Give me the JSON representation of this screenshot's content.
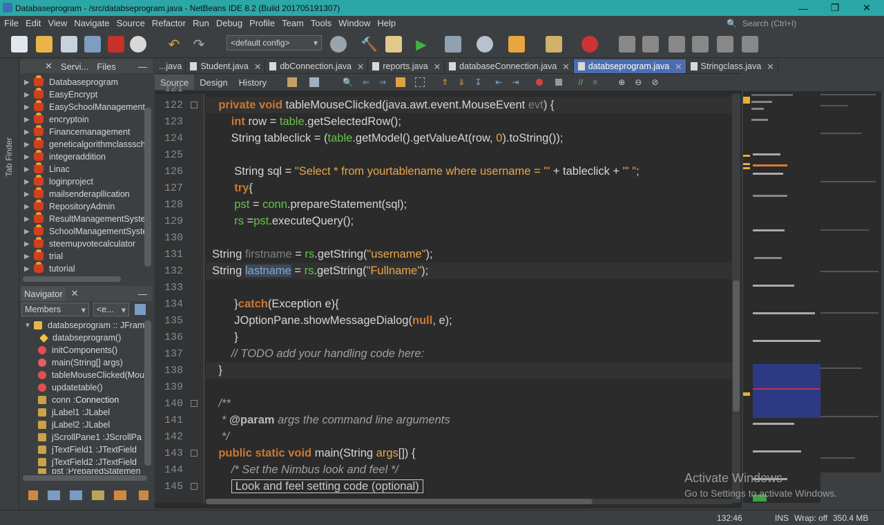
{
  "window": {
    "title": "Databaseprogram - /src/databseprogram.java - NetBeans IDE 8.2 (Build 201705191307)"
  },
  "menu": [
    "File",
    "Edit",
    "View",
    "Navigate",
    "Source",
    "Refactor",
    "Run",
    "Debug",
    "Profile",
    "Team",
    "Tools",
    "Window",
    "Help"
  ],
  "search": {
    "placeholder": "Search (Ctrl+I)"
  },
  "toolbar": {
    "config": "<default config>"
  },
  "left_strip": {
    "label": "Tab Finder"
  },
  "projects_panel": {
    "tabs": [
      "Servi...",
      "Files"
    ],
    "items": [
      "Databaseprogram",
      "EasyEncrypt",
      "EasySchoolManagement",
      "encryptoin",
      "Financemanagement",
      "geneticalgorithmclasssch",
      "integeraddition",
      "Linac",
      "loginproject",
      "mailsenderapllication",
      "RepositoryAdmin",
      "ResultManagementSyste",
      "SchoolManagementSyste",
      "steemupvotecalculator",
      "trial",
      "tutorial"
    ]
  },
  "navigator": {
    "title": "Navigator",
    "filter": "Members",
    "filter2": "<e...",
    "root": "databseprogram :: JFram",
    "members": [
      {
        "name": "databseprogram()",
        "type": ""
      },
      {
        "name": "initComponents()",
        "type": ""
      },
      {
        "name": "main(String[] args)",
        "type": ""
      },
      {
        "name": "tableMouseClicked(Mou",
        "type": ""
      },
      {
        "name": "updatetable()",
        "type": ""
      },
      {
        "name": "conn : ",
        "type": "Connection"
      },
      {
        "name": "jLabel1 : ",
        "type": "JLabel"
      },
      {
        "name": "jLabel2 : ",
        "type": "JLabel"
      },
      {
        "name": "jScrollPane1 : ",
        "type": "JScrollPa"
      },
      {
        "name": "jTextField1 : ",
        "type": "JTextField"
      },
      {
        "name": "jTextField2 : ",
        "type": "JTextField"
      },
      {
        "name": "pst : ",
        "type": "PreparedStatemen"
      }
    ]
  },
  "editor": {
    "tabs": [
      "...java",
      "Student.java",
      "dbConnection.java",
      "reports.java",
      "databaseConnection.java",
      "databseprogram.java",
      "Stringclass.java"
    ],
    "active_tab": "databseprogram.java",
    "views": [
      "Source",
      "Design",
      "History"
    ],
    "line_numbers": [
      "121",
      "122",
      "123",
      "124",
      "125",
      "126",
      "127",
      "128",
      "129",
      "130",
      "131",
      "132",
      "133",
      "134",
      "135",
      "136",
      "137",
      "138",
      "139",
      "140",
      "141",
      "142",
      "143",
      "144",
      "145"
    ]
  },
  "status": {
    "position": "132:46",
    "mode": "INS",
    "wrap": "Wrap: off",
    "memory": "350.4 MB"
  },
  "watermark": {
    "line1": "Activate Windows",
    "line2": "Go to Settings to activate Windows."
  },
  "colors": {
    "title_bar": "#2ca7a7",
    "active_tab": "#4b6eaf",
    "keyword": "#cc7832",
    "string": "#e8a64a",
    "field": "#8bd06e"
  }
}
